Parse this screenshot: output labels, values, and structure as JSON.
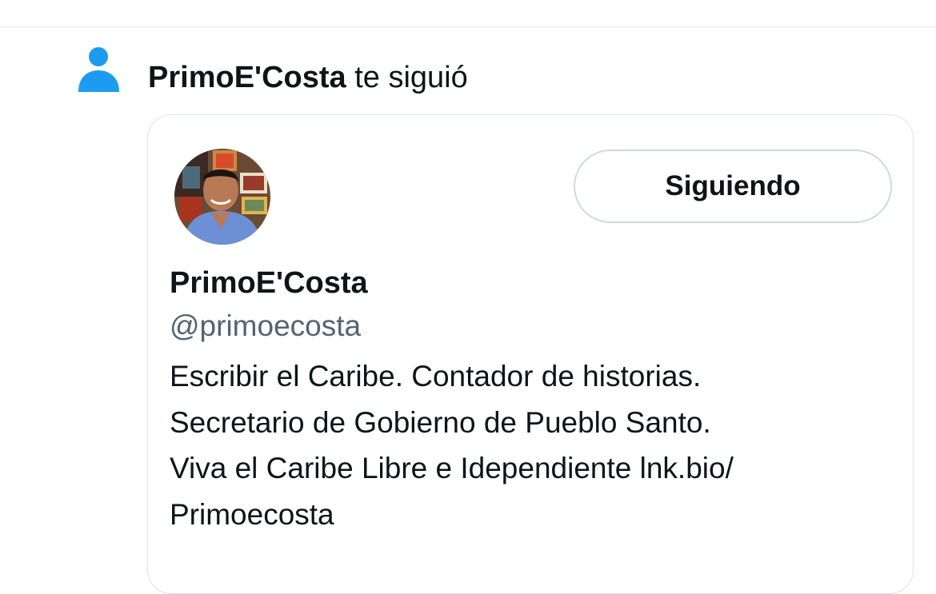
{
  "notification": {
    "icon": "person-icon",
    "icon_color": "#1d9bf0",
    "user_name": "PrimoE'Costa",
    "action_text": "te siguió"
  },
  "profile_card": {
    "avatar": "avatar-photo",
    "follow_button_label": "Siguiendo",
    "display_name": "PrimoE'Costa",
    "handle": "@primoecosta",
    "bio_lines": [
      "Escribir el Caribe. Contador de historias.",
      "Secretario de Gobierno de Pueblo Santo.",
      "Viva el Caribe Libre e Idependiente lnk.bio/",
      "Primoecosta"
    ]
  },
  "colors": {
    "text_primary": "#0f1419",
    "text_secondary": "#536471",
    "border": "#cfd9de",
    "accent": "#1d9bf0"
  }
}
